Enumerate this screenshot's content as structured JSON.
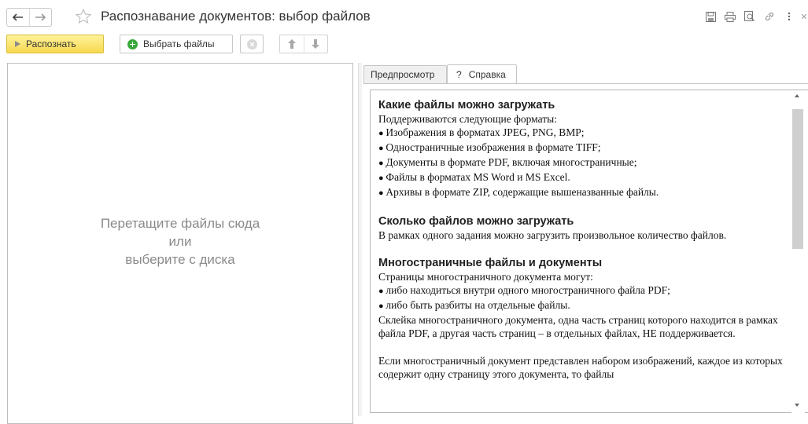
{
  "window": {
    "title": "Распознавание документов: выбор файлов"
  },
  "icons": {
    "back": "arrow-left-icon",
    "forward": "arrow-right-icon",
    "favorite": "star-icon",
    "save": "floppy-icon",
    "print": "printer-icon",
    "preview": "print-preview-icon",
    "link": "link-icon",
    "more": "more-vertical-icon",
    "close": "close-icon"
  },
  "toolbar": {
    "recognize_label": "Распознать",
    "select_files_label": "Выбрать файлы"
  },
  "dropzone": {
    "line1": "Перетащите файлы сюда",
    "line2": "или",
    "line3": "выберите с диска"
  },
  "tabs": [
    {
      "label": "Предпросмотр",
      "active": false
    },
    {
      "label": "Справка",
      "active": true,
      "prefix": "?"
    }
  ],
  "help": {
    "s1_title": "Какие файлы можно загружать",
    "s1_intro": "Поддерживаются следующие форматы:",
    "s1_items": [
      "Изображения в форматах JPEG, PNG, BMP;",
      "Одностраничные изображения в формате TIFF;",
      "Документы в формате PDF, включая многостраничные;",
      "Файлы в форматах MS Word и MS Excel.",
      "Архивы в формате ZIP, содержащие вышеназванные файлы."
    ],
    "s2_title": "Сколько файлов можно загружать",
    "s2_text": "В рамках одного задания можно загрузить произвольное количество файлов.",
    "s3_title": "Многостраничные файлы и документы",
    "s3_intro": "Страницы многостраничного документа могут:",
    "s3_items": [
      "либо находиться внутри одного многостраничного файла PDF;",
      "либо быть разбиты на отдельные файлы."
    ],
    "s3_text": "Склейка многостраничного документа, одна часть страниц которого находится в рамках файла PDF, а другая часть страниц – в отдельных файлах, НЕ поддерживается.",
    "s4_text": "Если многостраничный документ представлен набором изображений, каждое из которых содержит одну страницу этого документа, то файлы"
  },
  "colors": {
    "primary_button": "#f7d84f",
    "add_icon": "#3aa83a"
  }
}
